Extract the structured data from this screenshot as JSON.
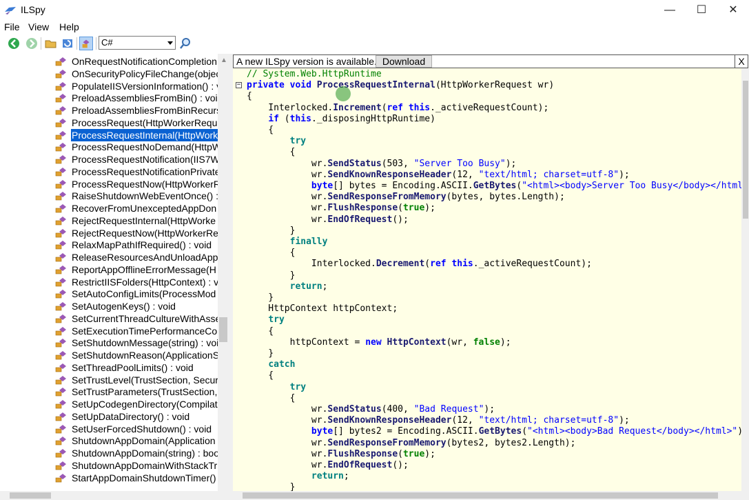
{
  "window": {
    "title": "ILSpy",
    "minimize": "—",
    "maximize": "☐",
    "close": "✕"
  },
  "menu": [
    "File",
    "View",
    "Help"
  ],
  "toolbar": {
    "language": "C#"
  },
  "notice": {
    "text": "A new ILSpy version is available.",
    "download": "Download",
    "close": "X"
  },
  "tree": {
    "items": [
      {
        "label": "OnRequestNotificationCompletion"
      },
      {
        "label": "OnSecurityPolicyFileChange(objec"
      },
      {
        "label": "PopulateIISVersionInformation() : v"
      },
      {
        "label": "PreloadAssembliesFromBin() : void"
      },
      {
        "label": "PreloadAssembliesFromBinRecurs"
      },
      {
        "label": "ProcessRequest(HttpWorkerRequ"
      },
      {
        "label": "ProcessRequestInternal(HttpWork",
        "selected": true
      },
      {
        "label": "ProcessRequestNoDemand(HttpW"
      },
      {
        "label": "ProcessRequestNotification(IIS7W"
      },
      {
        "label": "ProcessRequestNotificationPrivate"
      },
      {
        "label": "ProcessRequestNow(HttpWorkerR"
      },
      {
        "label": "RaiseShutdownWebEventOnce() : "
      },
      {
        "label": "RecoverFromUnexceptedAppDon"
      },
      {
        "label": "RejectRequestInternal(HttpWorke"
      },
      {
        "label": "RejectRequestNow(HttpWorkerRe"
      },
      {
        "label": "RelaxMapPathIfRequired() : void"
      },
      {
        "label": "ReleaseResourcesAndUnloadAppl"
      },
      {
        "label": "ReportAppOfflineErrorMessage(H"
      },
      {
        "label": "RestrictIISFolders(HttpContext) : v"
      },
      {
        "label": "SetAutoConfigLimits(ProcessMod"
      },
      {
        "label": "SetAutogenKeys() : void"
      },
      {
        "label": "SetCurrentThreadCultureWithAsse"
      },
      {
        "label": "SetExecutionTimePerformanceCou"
      },
      {
        "label": "SetShutdownMessage(string) : voi"
      },
      {
        "label": "SetShutdownReason(ApplicationS"
      },
      {
        "label": "SetThreadPoolLimits() : void"
      },
      {
        "label": "SetTrustLevel(TrustSection, Securi"
      },
      {
        "label": "SetTrustParameters(TrustSection,"
      },
      {
        "label": "SetUpCodegenDirectory(Compilat"
      },
      {
        "label": "SetUpDataDirectory() : void"
      },
      {
        "label": "SetUserForcedShutdown() : void"
      },
      {
        "label": "ShutdownAppDomain(Application"
      },
      {
        "label": "ShutdownAppDomain(string) : boo"
      },
      {
        "label": "ShutdownAppDomainWithStackTr"
      },
      {
        "label": "StartAppDomainShutdownTimer()"
      }
    ]
  },
  "code": {
    "lines": [
      {
        "fold": "",
        "parts": [
          [
            "cmt",
            "// System.Web.HttpRuntime"
          ]
        ]
      },
      {
        "fold": "−",
        "parts": [
          [
            "kw",
            "private"
          ],
          [
            "ty",
            " "
          ],
          [
            "kw",
            "void"
          ],
          [
            "ty",
            " "
          ],
          [
            "m",
            "ProcessRequestInternal"
          ],
          [
            "ty",
            "(HttpWorkerRequest wr)"
          ]
        ]
      },
      {
        "fold": "",
        "parts": [
          [
            "ty",
            "{"
          ]
        ]
      },
      {
        "fold": "",
        "parts": [
          [
            "ty",
            "    Interlocked."
          ],
          [
            "m",
            "Increment"
          ],
          [
            "ty",
            "("
          ],
          [
            "kw",
            "ref"
          ],
          [
            "ty",
            " "
          ],
          [
            "kw",
            "this"
          ],
          [
            "ty",
            "._activeRequestCount);"
          ]
        ]
      },
      {
        "fold": "",
        "parts": [
          [
            "ty",
            "    "
          ],
          [
            "kw",
            "if"
          ],
          [
            "ty",
            " ("
          ],
          [
            "kw",
            "this"
          ],
          [
            "ty",
            "._disposingHttpRuntime)"
          ]
        ]
      },
      {
        "fold": "",
        "parts": [
          [
            "ty",
            "    {"
          ]
        ]
      },
      {
        "fold": "",
        "parts": [
          [
            "ty",
            "        "
          ],
          [
            "kw2",
            "try"
          ]
        ]
      },
      {
        "fold": "",
        "parts": [
          [
            "ty",
            "        {"
          ]
        ]
      },
      {
        "fold": "",
        "parts": [
          [
            "ty",
            "            wr."
          ],
          [
            "m",
            "SendStatus"
          ],
          [
            "ty",
            "(503, "
          ],
          [
            "str",
            "\"Server Too Busy\""
          ],
          [
            "ty",
            ");"
          ]
        ]
      },
      {
        "fold": "",
        "parts": [
          [
            "ty",
            "            wr."
          ],
          [
            "m",
            "SendKnownResponseHeader"
          ],
          [
            "ty",
            "(12, "
          ],
          [
            "str",
            "\"text/html; charset=utf-8\""
          ],
          [
            "ty",
            ");"
          ]
        ]
      },
      {
        "fold": "",
        "parts": [
          [
            "kw",
            "            byte"
          ],
          [
            "ty",
            "[] bytes = Encoding.ASCII."
          ],
          [
            "m",
            "GetBytes"
          ],
          [
            "ty",
            "("
          ],
          [
            "str",
            "\"<html><body>Server Too Busy</body></html>\""
          ],
          [
            "ty",
            ");"
          ]
        ]
      },
      {
        "fold": "",
        "parts": [
          [
            "ty",
            "            wr."
          ],
          [
            "m",
            "SendResponseFromMemory"
          ],
          [
            "ty",
            "(bytes, bytes.Length);"
          ]
        ]
      },
      {
        "fold": "",
        "parts": [
          [
            "ty",
            "            wr."
          ],
          [
            "m",
            "FlushResponse"
          ],
          [
            "ty",
            "("
          ],
          [
            "valkw",
            "true"
          ],
          [
            "ty",
            ");"
          ]
        ]
      },
      {
        "fold": "",
        "parts": [
          [
            "ty",
            "            wr."
          ],
          [
            "m",
            "EndOfRequest"
          ],
          [
            "ty",
            "();"
          ]
        ]
      },
      {
        "fold": "",
        "parts": [
          [
            "ty",
            "        }"
          ]
        ]
      },
      {
        "fold": "",
        "parts": [
          [
            "ty",
            "        "
          ],
          [
            "kw2",
            "finally"
          ]
        ]
      },
      {
        "fold": "",
        "parts": [
          [
            "ty",
            "        {"
          ]
        ]
      },
      {
        "fold": "",
        "parts": [
          [
            "ty",
            "            Interlocked."
          ],
          [
            "m",
            "Decrement"
          ],
          [
            "ty",
            "("
          ],
          [
            "kw",
            "ref"
          ],
          [
            "ty",
            " "
          ],
          [
            "kw",
            "this"
          ],
          [
            "ty",
            "._activeRequestCount);"
          ]
        ]
      },
      {
        "fold": "",
        "parts": [
          [
            "ty",
            "        }"
          ]
        ]
      },
      {
        "fold": "",
        "parts": [
          [
            "ty",
            "        "
          ],
          [
            "kw2",
            "return"
          ],
          [
            "ty",
            ";"
          ]
        ]
      },
      {
        "fold": "",
        "parts": [
          [
            "ty",
            "    }"
          ]
        ]
      },
      {
        "fold": "",
        "parts": [
          [
            "ty",
            "    HttpContext httpContext;"
          ]
        ]
      },
      {
        "fold": "",
        "parts": [
          [
            "ty",
            "    "
          ],
          [
            "kw2",
            "try"
          ]
        ]
      },
      {
        "fold": "",
        "parts": [
          [
            "ty",
            "    {"
          ]
        ]
      },
      {
        "fold": "",
        "parts": [
          [
            "ty",
            "        httpContext = "
          ],
          [
            "kw",
            "new"
          ],
          [
            "ty",
            " "
          ],
          [
            "m",
            "HttpContext"
          ],
          [
            "ty",
            "(wr, "
          ],
          [
            "valkw",
            "false"
          ],
          [
            "ty",
            ");"
          ]
        ]
      },
      {
        "fold": "",
        "parts": [
          [
            "ty",
            "    }"
          ]
        ]
      },
      {
        "fold": "",
        "parts": [
          [
            "ty",
            "    "
          ],
          [
            "kw2",
            "catch"
          ]
        ]
      },
      {
        "fold": "",
        "parts": [
          [
            "ty",
            "    {"
          ]
        ]
      },
      {
        "fold": "",
        "parts": [
          [
            "ty",
            "        "
          ],
          [
            "kw2",
            "try"
          ]
        ]
      },
      {
        "fold": "",
        "parts": [
          [
            "ty",
            "        {"
          ]
        ]
      },
      {
        "fold": "",
        "parts": [
          [
            "ty",
            "            wr."
          ],
          [
            "m",
            "SendStatus"
          ],
          [
            "ty",
            "(400, "
          ],
          [
            "str",
            "\"Bad Request\""
          ],
          [
            "ty",
            ");"
          ]
        ]
      },
      {
        "fold": "",
        "parts": [
          [
            "ty",
            "            wr."
          ],
          [
            "m",
            "SendKnownResponseHeader"
          ],
          [
            "ty",
            "(12, "
          ],
          [
            "str",
            "\"text/html; charset=utf-8\""
          ],
          [
            "ty",
            ");"
          ]
        ]
      },
      {
        "fold": "",
        "parts": [
          [
            "kw",
            "            byte"
          ],
          [
            "ty",
            "[] bytes2 = Encoding.ASCII."
          ],
          [
            "m",
            "GetBytes"
          ],
          [
            "ty",
            "("
          ],
          [
            "str",
            "\"<html><body>Bad Request</body></html>\""
          ],
          [
            "ty",
            ");"
          ]
        ]
      },
      {
        "fold": "",
        "parts": [
          [
            "ty",
            "            wr."
          ],
          [
            "m",
            "SendResponseFromMemory"
          ],
          [
            "ty",
            "(bytes2, bytes2.Length);"
          ]
        ]
      },
      {
        "fold": "",
        "parts": [
          [
            "ty",
            "            wr."
          ],
          [
            "m",
            "FlushResponse"
          ],
          [
            "ty",
            "("
          ],
          [
            "valkw",
            "true"
          ],
          [
            "ty",
            ");"
          ]
        ]
      },
      {
        "fold": "",
        "parts": [
          [
            "ty",
            "            wr."
          ],
          [
            "m",
            "EndOfRequest"
          ],
          [
            "ty",
            "();"
          ]
        ]
      },
      {
        "fold": "",
        "parts": [
          [
            "ty",
            "            "
          ],
          [
            "kw2",
            "return"
          ],
          [
            "ty",
            ";"
          ]
        ]
      },
      {
        "fold": "",
        "parts": [
          [
            "ty",
            "        }"
          ]
        ]
      }
    ]
  }
}
